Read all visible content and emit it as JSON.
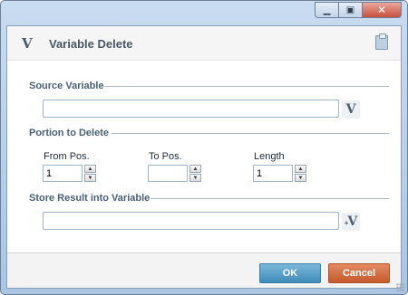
{
  "window": {
    "controls": {
      "minimize": "▁",
      "restore": "▣",
      "close": "✕"
    }
  },
  "header": {
    "logo": "V",
    "title": "Variable Delete",
    "icon": "clipboard-icon"
  },
  "source": {
    "label": "Source Variable",
    "value": "",
    "var_button": "V"
  },
  "portion": {
    "label": "Portion to Delete",
    "from_label": "From Pos.",
    "from_value": "1",
    "to_label": "To Pos.",
    "to_value": "",
    "length_label": "Length",
    "length_value": "1"
  },
  "store": {
    "label": "Store Result into Variable",
    "value": "",
    "var_button_plus": "+",
    "var_button": "V"
  },
  "footer": {
    "ok_label": "OK",
    "cancel_label": "Cancel"
  },
  "colors": {
    "ok": "#3f8dbb",
    "cancel": "#c45a2c",
    "close": "#c7503c"
  }
}
